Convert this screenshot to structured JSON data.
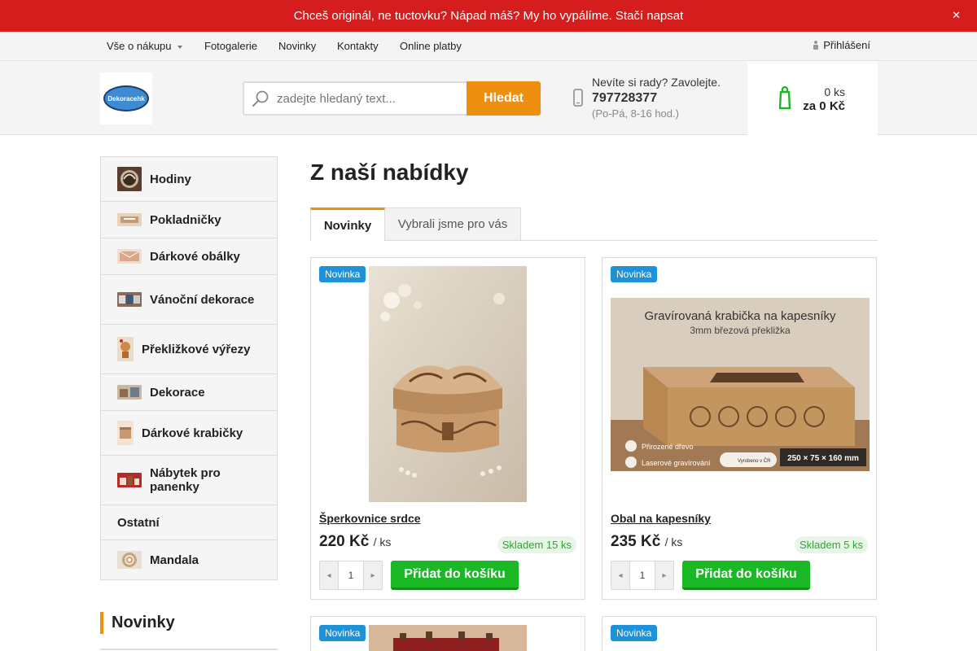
{
  "banner": {
    "text": "Chceš originál, ne tuctovku? Nápad máš? My ho vypálíme. Stačí napsat",
    "close": "✕"
  },
  "topnav": {
    "items": [
      "Vše o nákupu",
      "Fotogalerie",
      "Novinky",
      "Kontakty",
      "Online platby"
    ],
    "login": "Přihlášení"
  },
  "logo": {
    "text": "Dekoracehk"
  },
  "search": {
    "placeholder": "zadejte hledaný text...",
    "button": "Hledat"
  },
  "contact": {
    "question": "Nevíte si rady? Zavolejte.",
    "phone": "797728377",
    "hours": "(Po-Pá, 8-16 hod.)"
  },
  "cart": {
    "count": "0 ks",
    "total": "za 0 Kč"
  },
  "sidebar": {
    "categories": [
      {
        "label": "Hodiny"
      },
      {
        "label": "Pokladničky"
      },
      {
        "label": "Dárkové obálky"
      },
      {
        "label": "Vánoční dekorace"
      },
      {
        "label": "Překližkové výřezy"
      },
      {
        "label": "Dekorace"
      },
      {
        "label": "Dárkové krabičky"
      },
      {
        "label": "Nábytek pro panenky"
      },
      {
        "label": "Ostatní"
      },
      {
        "label": "Mandala"
      }
    ],
    "news_heading": "Novinky"
  },
  "main": {
    "title": "Z naší nabídky",
    "tabs": [
      {
        "label": "Novinky"
      },
      {
        "label": "Vybrali jsme pro vás"
      }
    ]
  },
  "products": [
    {
      "badge": "Novinka",
      "name": "Šperkovnice srdce",
      "price": "220 Kč",
      "unit": "/ ks",
      "stock": "Skladem 15 ks",
      "qty": "1",
      "button": "Přidat do košíku"
    },
    {
      "badge": "Novinka",
      "name": "Obal na kapesníky",
      "price": "235 Kč",
      "unit": "/ ks",
      "stock": "Skladem 5 ks",
      "qty": "1",
      "button": "Přidat do košíku",
      "image_text": {
        "title": "Gravírovaná krabička na kapesníky",
        "subtitle": "3mm březová překližka",
        "feature1": "Přirozené dřevo",
        "feature2": "Laserové gravírování",
        "made": "Vyrobeno v ČR",
        "dims": "250 × 75 × 160 mm"
      }
    },
    {
      "badge": "Novinka"
    },
    {
      "badge": "Novinka"
    }
  ]
}
